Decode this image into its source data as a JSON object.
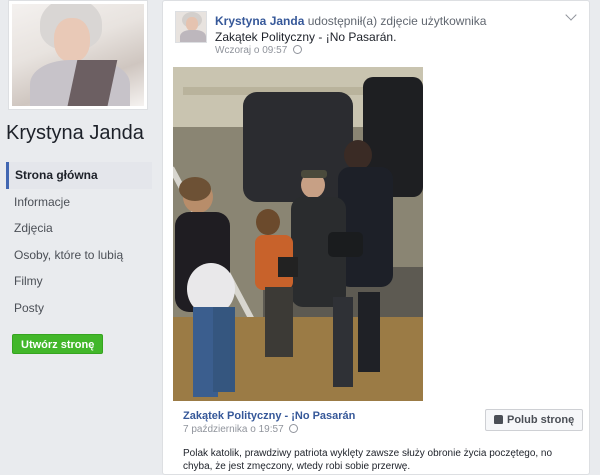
{
  "sidebar": {
    "page_name": "Krystyna Janda",
    "nav": [
      {
        "label": "Strona główna",
        "active": true
      },
      {
        "label": "Informacje"
      },
      {
        "label": "Zdjęcia"
      },
      {
        "label": "Osoby, które to lubią"
      },
      {
        "label": "Filmy"
      },
      {
        "label": "Posty"
      }
    ],
    "create_page_label": "Utwórz stronę"
  },
  "post": {
    "author": "Krystyna Janda",
    "action_text": "udostępnił(a) zdjęcie użytkownika",
    "shared_page": "Zakątek Polityczny - ¡No Pasarán.",
    "timestamp": "Wczoraj o 09:57",
    "privacy_icon": "globe-icon",
    "shared": {
      "page_name": "Zakątek Polityczny - ¡No Pasarán",
      "date": "7 października o 19:57",
      "like_page_label": "Polub stronę",
      "text": "Polak katolik, prawdziwy patriota wyklęty zawsze służy obronie życia poczętego, no chyba, że jest zmęczony, wtedy robi sobie przerwę."
    }
  },
  "colors": {
    "link": "#365899",
    "green_button": "#42b72a",
    "background": "#e9ebee"
  }
}
